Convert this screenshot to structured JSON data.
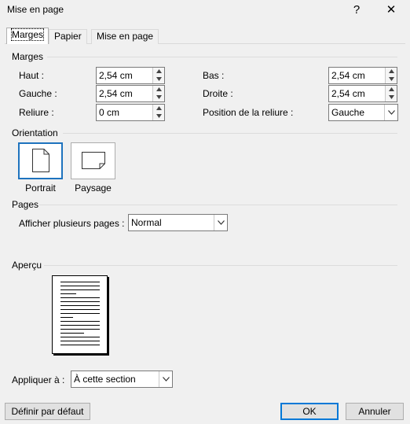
{
  "window": {
    "title": "Mise en page",
    "help_label": "?",
    "close_label": "✕"
  },
  "tabs": [
    {
      "label": "Marges",
      "active": true
    },
    {
      "label": "Papier",
      "active": false
    },
    {
      "label": "Mise en page",
      "active": false
    }
  ],
  "margins": {
    "group_label": "Marges",
    "haut": {
      "label": "Haut :",
      "value": "2,54 cm"
    },
    "bas": {
      "label": "Bas :",
      "value": "2,54 cm"
    },
    "gauche": {
      "label": "Gauche :",
      "value": "2,54 cm"
    },
    "droite": {
      "label": "Droite :",
      "value": "2,54 cm"
    },
    "reliure": {
      "label": "Reliure :",
      "value": "0 cm"
    },
    "position_reliure": {
      "label": "Position de la reliure :",
      "value": "Gauche"
    }
  },
  "orientation": {
    "group_label": "Orientation",
    "portrait_label": "Portrait",
    "paysage_label": "Paysage",
    "selected": "portrait"
  },
  "pages": {
    "group_label": "Pages",
    "multiple_label": "Afficher plusieurs pages :",
    "multiple_value": "Normal"
  },
  "apercu": {
    "group_label": "Aperçu"
  },
  "apply": {
    "label": "Appliquer à :",
    "value": "À cette section"
  },
  "footer": {
    "default_label": "Définir par défaut",
    "ok_label": "OK",
    "cancel_label": "Annuler"
  },
  "colors": {
    "accent": "#0078d7",
    "dialog_bg": "#f0f0f0"
  }
}
